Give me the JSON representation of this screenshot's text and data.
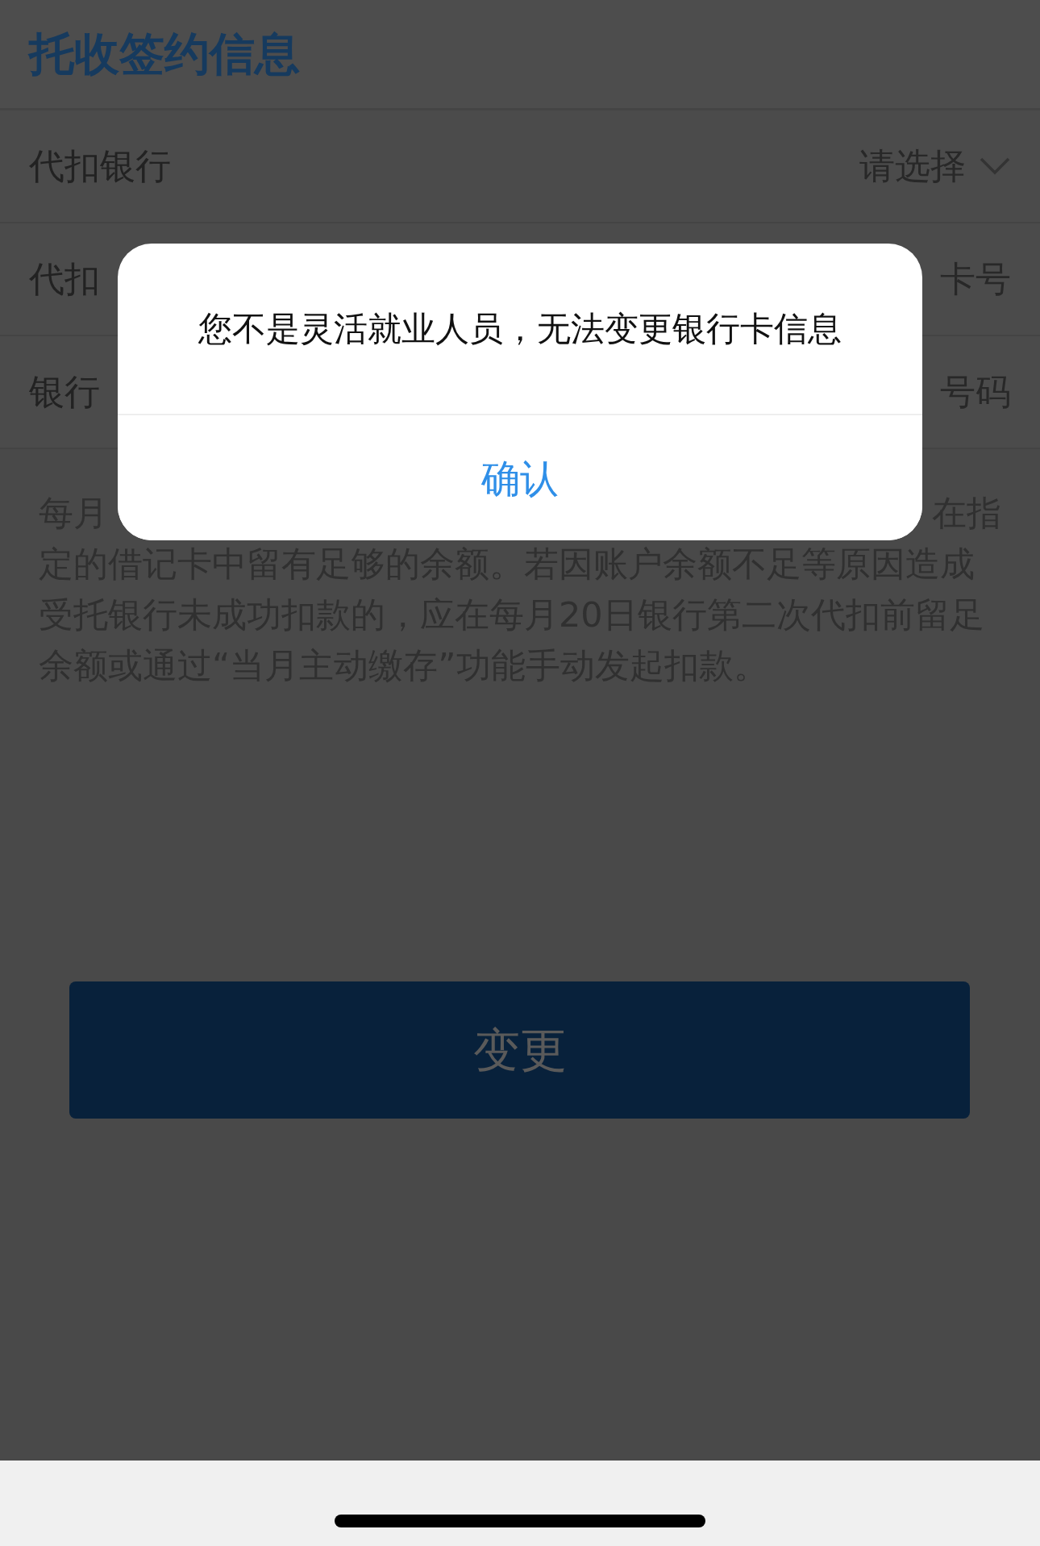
{
  "header": {
    "title": "托收签约信息"
  },
  "form_rows": [
    {
      "label": "代扣银行",
      "value": "请选择",
      "kind": "select"
    },
    {
      "label": "代扣",
      "value": "卡号",
      "kind": "input"
    },
    {
      "label": "银行",
      "value": "号码",
      "kind": "input"
    }
  ],
  "notice": {
    "first_line_start": "每月",
    "first_line_end": "在指",
    "lines": [
      "定的借记卡中留有足够的余额。若因账户余额不足等原因造成",
      "受托银行未成功扣款的，应在每月20日银行第二次代扣前留足",
      "余额或通过“当月主动缴存”功能手动发起扣款。"
    ]
  },
  "primary_button": {
    "label": "变更"
  },
  "dialog": {
    "message": "您不是灵活就业人员，无法变更银行卡信息",
    "confirm": "确认"
  }
}
